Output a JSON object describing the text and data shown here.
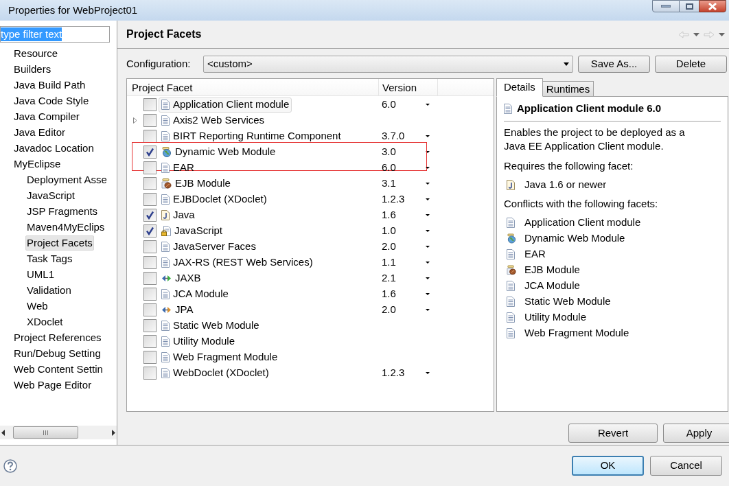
{
  "window": {
    "title": "Properties for WebProject01"
  },
  "filter": {
    "value": "type filter text"
  },
  "tree": [
    {
      "label": "Resource",
      "selected": false
    },
    {
      "label": "Builders",
      "selected": false
    },
    {
      "label": "Java Build Path",
      "selected": false
    },
    {
      "label": "Java Code Style",
      "selected": false
    },
    {
      "label": "Java Compiler",
      "selected": false
    },
    {
      "label": "Java Editor",
      "selected": false
    },
    {
      "label": "Javadoc Location",
      "selected": false
    },
    {
      "label": "MyEclipse",
      "selected": false,
      "children": [
        {
          "label": "Deployment Asse",
          "selected": false
        },
        {
          "label": "JavaScript",
          "selected": false
        },
        {
          "label": "JSP Fragments",
          "selected": false
        },
        {
          "label": "Maven4MyEclips",
          "selected": false
        },
        {
          "label": "Project Facets",
          "selected": true
        },
        {
          "label": "Task Tags",
          "selected": false
        },
        {
          "label": "UML1",
          "selected": false
        },
        {
          "label": "Validation",
          "selected": false
        },
        {
          "label": "Web",
          "selected": false
        },
        {
          "label": "XDoclet",
          "selected": false
        }
      ]
    },
    {
      "label": "Project References",
      "selected": false
    },
    {
      "label": "Run/Debug Setting",
      "selected": false
    },
    {
      "label": "Web Content Settin",
      "selected": false
    },
    {
      "label": "Web Page Editor",
      "selected": false
    }
  ],
  "page": {
    "title": "Project Facets",
    "configuration_label": "Configuration:",
    "configuration_value": "<custom>",
    "buttons": [
      "Save As...",
      "Delete"
    ]
  },
  "facets_table": {
    "columns": [
      "Project Facet",
      "Version"
    ],
    "rows": [
      {
        "name": "Application Client module",
        "version": "6.0",
        "checked": false,
        "selected": true,
        "highlighted": false,
        "expandable": false,
        "kind": "doc"
      },
      {
        "name": "Axis2 Web Services",
        "checked": false,
        "selected": false,
        "highlighted": false,
        "expandable": true,
        "kind": "doc"
      },
      {
        "name": "BIRT Reporting Runtime Component",
        "version": "3.7.0",
        "checked": false,
        "selected": false,
        "highlighted": false,
        "expandable": false,
        "kind": "doc"
      },
      {
        "name": "Dynamic Web Module",
        "version": "3.0",
        "checked": true,
        "selected": false,
        "highlighted": true,
        "expandable": false,
        "kind": "webjar"
      },
      {
        "name": "EAR",
        "version": "6.0",
        "checked": false,
        "selected": false,
        "highlighted": false,
        "expandable": false,
        "kind": "doc"
      },
      {
        "name": "EJB Module",
        "version": "3.1",
        "checked": false,
        "selected": false,
        "highlighted": false,
        "expandable": false,
        "kind": "beanjar"
      },
      {
        "name": "EJBDoclet (XDoclet)",
        "version": "1.2.3",
        "checked": false,
        "selected": false,
        "highlighted": false,
        "expandable": false,
        "kind": "doc"
      },
      {
        "name": "Java",
        "version": "1.6",
        "checked": true,
        "selected": false,
        "highlighted": false,
        "expandable": false,
        "kind": "java"
      },
      {
        "name": "JavaScript",
        "version": "1.0",
        "checked": true,
        "selected": false,
        "highlighted": false,
        "expandable": false,
        "kind": "lockdoc"
      },
      {
        "name": "JavaServer Faces",
        "version": "2.0",
        "checked": false,
        "selected": false,
        "highlighted": false,
        "expandable": false,
        "kind": "doc"
      },
      {
        "name": "JAX-RS (REST Web Services)",
        "version": "1.1",
        "checked": false,
        "selected": false,
        "highlighted": false,
        "expandable": false,
        "kind": "doc"
      },
      {
        "name": "JAXB",
        "version": "2.1",
        "checked": false,
        "selected": false,
        "highlighted": false,
        "expandable": false,
        "kind": "greenarrows"
      },
      {
        "name": "JCA Module",
        "version": "1.6",
        "checked": false,
        "selected": false,
        "highlighted": false,
        "expandable": false,
        "kind": "doc"
      },
      {
        "name": "JPA",
        "version": "2.0",
        "checked": false,
        "selected": false,
        "highlighted": false,
        "expandable": false,
        "kind": "orangearrows"
      },
      {
        "name": "Static Web Module",
        "checked": false,
        "selected": false,
        "highlighted": false,
        "expandable": false,
        "kind": "doc"
      },
      {
        "name": "Utility Module",
        "checked": false,
        "selected": false,
        "highlighted": false,
        "expandable": false,
        "kind": "doc"
      },
      {
        "name": "Web Fragment Module",
        "checked": false,
        "selected": false,
        "highlighted": false,
        "expandable": false,
        "kind": "doc"
      },
      {
        "name": "WebDoclet (XDoclet)",
        "version": "1.2.3",
        "checked": false,
        "selected": false,
        "highlighted": false,
        "expandable": false,
        "kind": "doc"
      }
    ]
  },
  "details": {
    "tabs": [
      {
        "label": "Details",
        "selected": true
      },
      {
        "label": "Runtimes",
        "selected": false
      }
    ],
    "heading": {
      "label": "Application Client module 6.0",
      "kind": "doc"
    },
    "description": "Enables the project to be deployed as a Java EE Application Client module.",
    "requires_label": "Requires the following facet:",
    "requires": [
      {
        "label": "Java 1.6 or newer",
        "kind": "java"
      }
    ],
    "conflicts_label": "Conflicts with the following facets:",
    "conflicts": [
      {
        "label": "Application Client module",
        "kind": "doc"
      },
      {
        "label": "Dynamic Web Module",
        "kind": "webjar"
      },
      {
        "label": "EAR",
        "kind": "doc"
      },
      {
        "label": "EJB Module",
        "kind": "beanjar"
      },
      {
        "label": "JCA Module",
        "kind": "doc"
      },
      {
        "label": "Static Web Module",
        "kind": "doc"
      },
      {
        "label": "Utility Module",
        "kind": "doc"
      },
      {
        "label": "Web Fragment Module",
        "kind": "doc"
      }
    ]
  },
  "page_buttons": [
    "Revert",
    "Apply"
  ],
  "dialog_buttons": [
    {
      "label": "OK",
      "default": true
    },
    {
      "label": "Cancel",
      "default": false
    }
  ]
}
